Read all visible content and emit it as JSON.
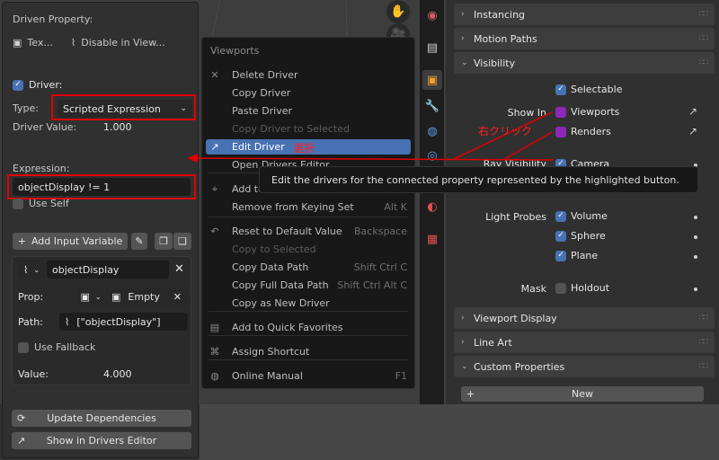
{
  "driver_panel": {
    "heading": "Driven Property:",
    "driven_object": "Tex...",
    "driven_property": "Disable in View...",
    "driver_checkbox_label": "Driver:",
    "type_label": "Type:",
    "type_value": "Scripted Expression",
    "driver_value_label": "Driver Value:",
    "driver_value": "1.000",
    "expression_label": "Expression:",
    "expression_value": "objectDisplay != 1",
    "use_self_label": "Use Self",
    "add_input_variable_label": "Add Input Variable",
    "variable": {
      "name": "objectDisplay",
      "prop_label": "Prop:",
      "prop_value": "Empty",
      "path_label": "Path:",
      "path_value": "[\"objectDisplay\"]",
      "use_fallback_label": "Use Fallback",
      "value_label": "Value:",
      "value": "4.000"
    },
    "update_dependencies_label": "Update Dependencies",
    "show_in_drivers_editor_label": "Show in Drivers Editor"
  },
  "context_menu": {
    "title": "Viewports",
    "items": [
      {
        "label": "Delete Driver",
        "shortcut": "",
        "icon": "close-icon",
        "disabled": false
      },
      {
        "label": "Copy Driver",
        "shortcut": "",
        "icon": "",
        "disabled": false
      },
      {
        "label": "Paste Driver",
        "shortcut": "",
        "icon": "",
        "disabled": false
      },
      {
        "label": "Copy Driver to Selected",
        "shortcut": "",
        "icon": "",
        "disabled": true
      },
      {
        "label": "Edit Driver",
        "shortcut": "",
        "icon": "driver-icon",
        "disabled": false
      },
      {
        "label": "Open Drivers Editor",
        "shortcut": "",
        "icon": "",
        "disabled": false
      },
      {
        "label": "Add to",
        "shortcut": "",
        "icon": "keyingset-icon",
        "disabled": false
      },
      {
        "label": "Remove from Keying Set",
        "shortcut": "Alt K",
        "icon": "",
        "disabled": false
      },
      {
        "label": "Reset to Default Value",
        "shortcut": "Backspace",
        "icon": "reset-icon",
        "disabled": false
      },
      {
        "label": "Copy to Selected",
        "shortcut": "",
        "icon": "",
        "disabled": true
      },
      {
        "label": "Copy Data Path",
        "shortcut": "Shift Ctrl C",
        "icon": "",
        "disabled": false
      },
      {
        "label": "Copy Full Data Path",
        "shortcut": "Shift Ctrl Alt C",
        "icon": "",
        "disabled": false
      },
      {
        "label": "Copy as New Driver",
        "shortcut": "",
        "icon": "",
        "disabled": false
      },
      {
        "label": "Add to Quick Favorites",
        "shortcut": "",
        "icon": "favorites-icon",
        "disabled": false
      },
      {
        "label": "Assign Shortcut",
        "shortcut": "",
        "icon": "keyboard-icon",
        "disabled": false
      },
      {
        "label": "Online Manual",
        "shortcut": "F1",
        "icon": "globe-icon",
        "disabled": false
      }
    ]
  },
  "tooltip": {
    "text": "Edit the drivers for the connected property represented by the highlighted button."
  },
  "annotations": {
    "right_click": "右クリック",
    "select": "選択"
  },
  "properties": {
    "sections": {
      "instancing": "Instancing",
      "motion_paths": "Motion Paths",
      "visibility": "Visibility",
      "viewport_display": "Viewport Display",
      "line_art": "Line Art",
      "custom_properties": "Custom Properties"
    },
    "visibility": {
      "selectable": "Selectable",
      "show_in_label": "Show In",
      "viewports": "Viewports",
      "renders": "Renders",
      "ray_visibility_label": "Ray Visibility",
      "camera": "Camera",
      "light_probes_label": "Light Probes",
      "volume": "Volume",
      "sphere": "Sphere",
      "plane": "Plane",
      "mask_label": "Mask",
      "holdout": "Holdout"
    },
    "new_button": "New"
  },
  "colors": {
    "accent": "#4772b3",
    "driven": "#8e27b8",
    "annotation": "#e00000"
  }
}
